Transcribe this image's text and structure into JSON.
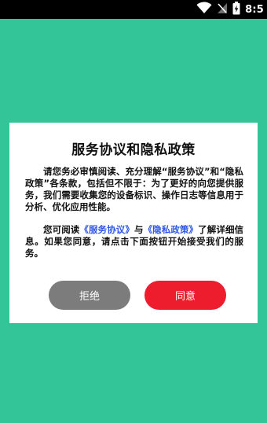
{
  "status_bar": {
    "time": "8:5",
    "icons": [
      "wifi-icon",
      "signal-icon",
      "battery-icon"
    ]
  },
  "dialog": {
    "title": "服务协议和隐私政策",
    "paragraph1": "请您务必审慎阅读、充分理解“服务协议”和“隐私政策”各条款，包括但不限于：为了更好的向您提供服务，我们需要收集您的设备标识、操作日志等信息用于分析、优化应用性能。",
    "paragraph2": {
      "prefix": "您可阅读",
      "link1": "《服务协议》",
      "middle": "与",
      "link2": "《隐私政策》",
      "suffix": "了解详细信息。如果您同意，请点击下面按钮开始接受我们的服务。"
    },
    "reject_label": "拒绝",
    "agree_label": "同意"
  },
  "colors": {
    "background": "#33c597",
    "reject_button": "#7c7c7c",
    "agree_button": "#ee1d2d",
    "link": "#2e57e6"
  }
}
